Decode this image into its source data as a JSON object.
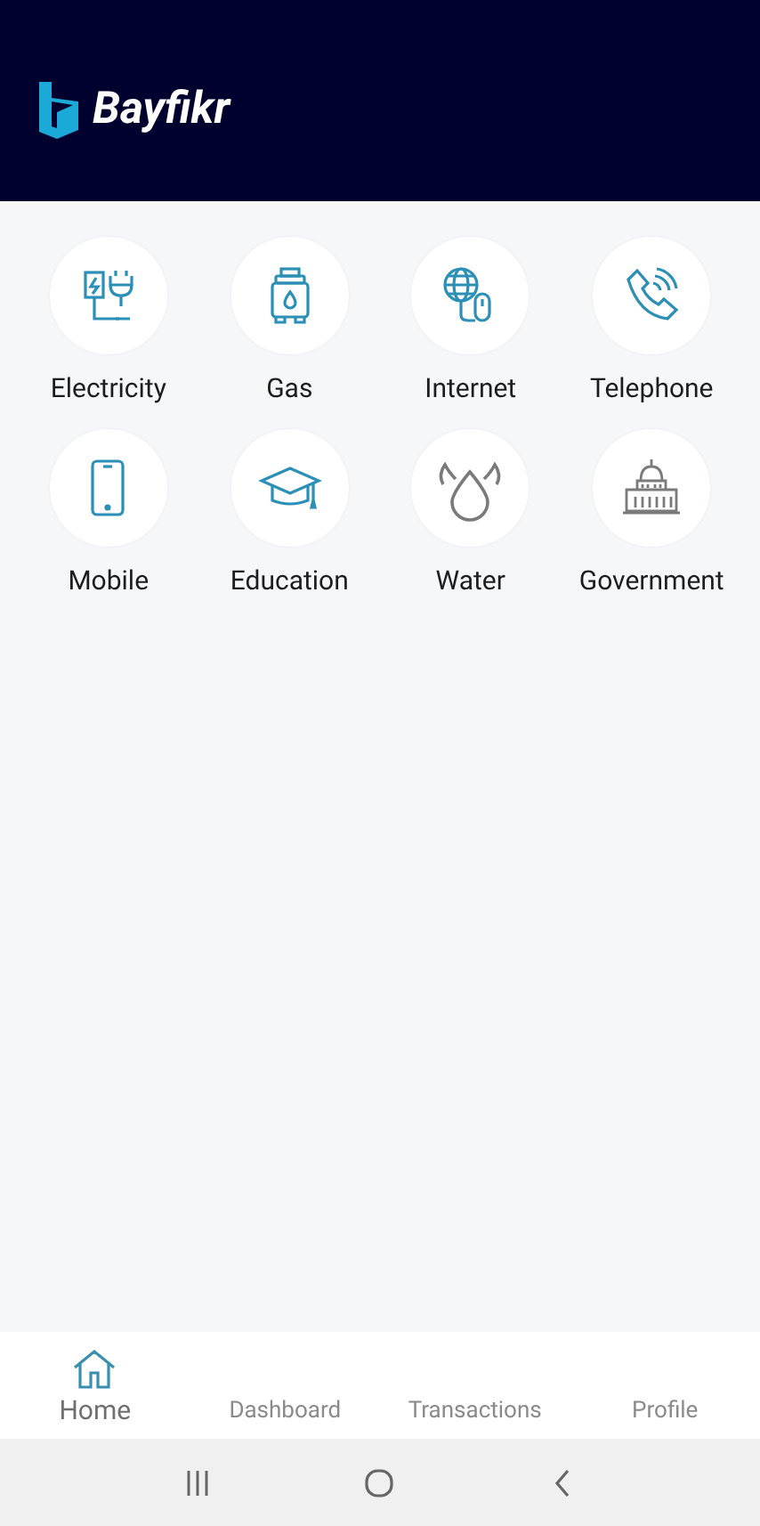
{
  "header": {
    "logo_text": "Bayfikr"
  },
  "categories": [
    {
      "label": "Electricity"
    },
    {
      "label": "Gas"
    },
    {
      "label": "Internet"
    },
    {
      "label": "Telephone"
    },
    {
      "label": "Mobile"
    },
    {
      "label": "Education"
    },
    {
      "label": "Water"
    },
    {
      "label": "Government"
    }
  ],
  "bottom_nav": [
    {
      "label": "Home",
      "selected": true
    },
    {
      "label": "Dashboard",
      "selected": false
    },
    {
      "label": "Transactions",
      "selected": false
    },
    {
      "label": "Profile",
      "selected": false
    }
  ]
}
